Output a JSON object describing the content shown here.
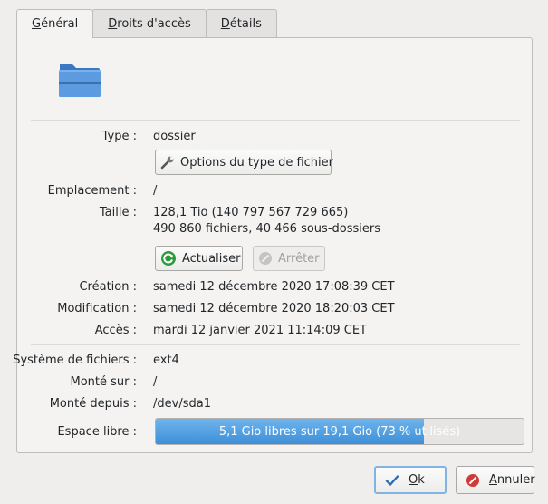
{
  "tabs": [
    {
      "label": "Général",
      "mnemonic": "G",
      "rest": "énéral",
      "active": true
    },
    {
      "label": "Droits d'accès",
      "mnemonic": "D",
      "rest": "roits d'accès",
      "active": false
    },
    {
      "label": "Détails",
      "mnemonic": "D",
      "rest": "étails",
      "active": false
    }
  ],
  "icons": {
    "folder": "folder-icon",
    "file_type_options": "wrench-icon",
    "refresh": "refresh-icon",
    "stop": "stop-icon",
    "ok": "checkmark-icon",
    "cancel": "cancel-icon"
  },
  "general": {
    "type": {
      "label": "Type :",
      "value": "dossier"
    },
    "file_type_options_button": "Options du type de fichier",
    "location": {
      "label": "Emplacement :",
      "value": "/"
    },
    "size": {
      "label": "Taille :",
      "value_line1": "128,1 Tio (140 797 567 729 665)",
      "value_line2": "490 860 fichiers, 40 466 sous-dossiers"
    },
    "refresh_button": "Actualiser",
    "stop_button": "Arrêter",
    "created": {
      "label": "Création :",
      "value": "samedi 12 décembre 2020 17:08:39 CET"
    },
    "modified": {
      "label": "Modification :",
      "value": "samedi 12 décembre 2020 18:20:03 CET"
    },
    "accessed": {
      "label": "Accès :",
      "value": "mardi 12 janvier 2021 11:14:09 CET"
    },
    "filesystem": {
      "label": "Système de fichiers :",
      "value": "ext4"
    },
    "mounted_on": {
      "label": "Monté sur :",
      "value": "/"
    },
    "mounted_from": {
      "label": "Monté depuis :",
      "value": "/dev/sda1"
    },
    "free_space": {
      "label": "Espace libre :",
      "text": "5,1 Gio libres sur 19,1 Gio (73 % utilisés)",
      "used_percent": 73
    }
  },
  "buttons": {
    "ok": {
      "label": "Ok",
      "mnemonic": "O",
      "rest": "k"
    },
    "cancel": {
      "label": "Annuler",
      "mnemonic": "A",
      "rest": "nnuler"
    }
  },
  "colors": {
    "accent": "#3d8fd8",
    "progress_fill": "#5aa3e4",
    "refresh_green": "#2a9b3a",
    "cancel_red": "#d03a3a",
    "focus_border": "#7fb4e3"
  }
}
